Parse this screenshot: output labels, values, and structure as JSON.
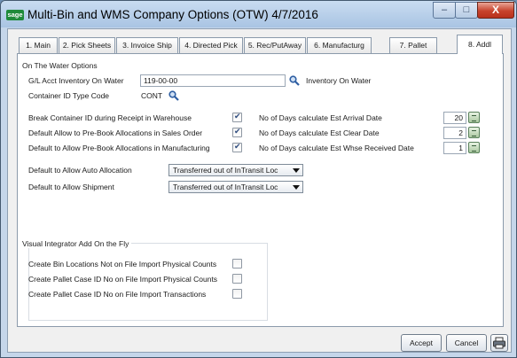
{
  "window": {
    "logo": "sage",
    "title": "Multi-Bin and WMS Company Options (OTW) 4/7/2016",
    "minimize": "–",
    "maximize": "□",
    "close": "X"
  },
  "tabs": [
    {
      "label": "1. Main",
      "active": false
    },
    {
      "label": "2. Pick Sheets",
      "active": false
    },
    {
      "label": "3. Invoice Ship",
      "active": false
    },
    {
      "label": "4. Directed Pick",
      "active": false
    },
    {
      "label": "5. Rec/PutAway",
      "active": false
    },
    {
      "label": "6. Manufacturg",
      "active": false
    },
    {
      "label": "7. Pallet",
      "active": false
    },
    {
      "label": "8. Addl",
      "active": true
    }
  ],
  "otw": {
    "section_title": "On The Water Options",
    "gl_label": "G/L Acct Inventory On Water",
    "gl_value": "119-00-00",
    "gl_description": "Inventory On Water",
    "container_label": "Container ID Type Code",
    "container_value": "CONT",
    "checks": [
      {
        "label": "Break Container ID during Receipt in Warehouse",
        "checked": true
      },
      {
        "label": "Default Allow to Pre-Book Allocations in Sales Order",
        "checked": true
      },
      {
        "label": "Default to Allow Pre-Book Allocations in Manufacturing",
        "checked": true
      }
    ],
    "days": [
      {
        "label": "No of Days calculate Est Arrival Date",
        "value": "20"
      },
      {
        "label": "No of Days calculate Est Clear Date",
        "value": "2"
      },
      {
        "label": "No of Days calculate Est Whse Received Date",
        "value": "1"
      }
    ],
    "dropdowns": [
      {
        "label": "Default to Allow Auto Allocation",
        "value": "Transferred out of InTransit Loc"
      },
      {
        "label": "Default to Allow Shipment",
        "value": "Transferred out of InTransit Loc"
      }
    ]
  },
  "vi": {
    "section_title": "Visual Integrator Add On the Fly",
    "checks": [
      {
        "label": "Create Bin Locations Not on File Import Physical Counts",
        "checked": false
      },
      {
        "label": "Create Pallet Case ID No on File Import Physical Counts",
        "checked": false
      },
      {
        "label": "Create Pallet Case ID No on File Import Transactions",
        "checked": false
      }
    ]
  },
  "buttons": {
    "accept": "Accept",
    "cancel": "Cancel"
  }
}
